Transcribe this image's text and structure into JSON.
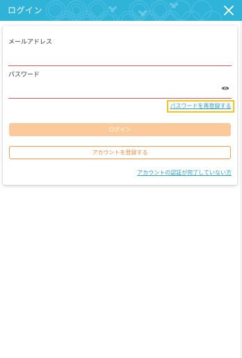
{
  "header": {
    "title": "ログイン",
    "close_icon": "close-icon",
    "background_color": "#2fb3d9"
  },
  "form": {
    "email_label": "メールアドレス",
    "email_value": "",
    "password_label": "パスワード",
    "password_value": "",
    "eye_icon": "eye-icon",
    "reset_password_link": "パスワードを再登録する",
    "login_button": "ログイン",
    "register_button": "アカウントを登録する",
    "verify_link": "アカウントの認証が完了していない方"
  },
  "colors": {
    "accent_orange": "#f0883a",
    "login_button_bg": "#fcc99a",
    "link_blue": "#2a9fc8",
    "field_underline": "#e05a5a",
    "highlight_border": "#f4c320"
  }
}
